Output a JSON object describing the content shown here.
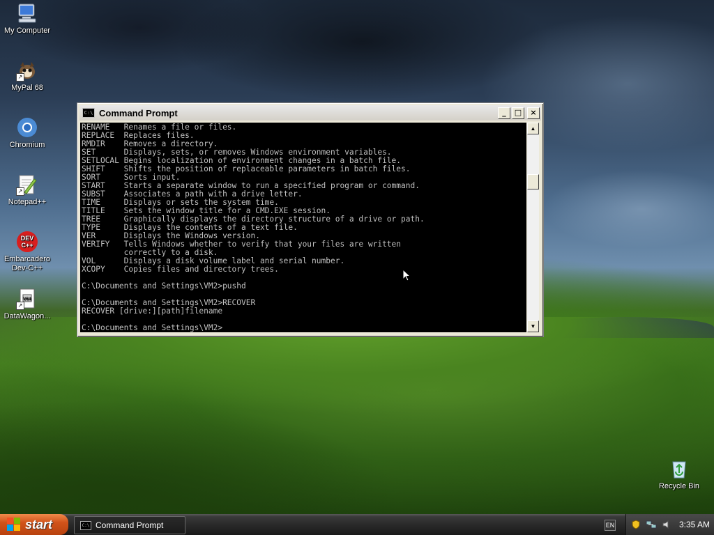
{
  "desktop": {
    "icons": [
      {
        "label": "My Computer",
        "icon": "my-computer-icon"
      },
      {
        "label": "MyPal 68",
        "icon": "mypal-icon"
      },
      {
        "label": "Chromium",
        "icon": "chromium-icon"
      },
      {
        "label": "Notepad++",
        "icon": "notepadpp-icon"
      },
      {
        "label": "Embarcadero Dev-C++",
        "line1": "Embarcadero",
        "line2": "Dev-C++",
        "icon": "devcpp-icon",
        "badge": "DEV\nC++"
      },
      {
        "label": "DataWagon...",
        "icon": "datawagon-icon"
      },
      {
        "label": "Recycle Bin",
        "icon": "recycle-bin-icon"
      }
    ]
  },
  "window": {
    "title": "Command Prompt",
    "icon_text": "C:\\",
    "buttons": {
      "minimize": "_",
      "maximize": "□",
      "close": "×"
    },
    "console_lines": [
      "RENAME   Renames a file or files.",
      "REPLACE  Replaces files.",
      "RMDIR    Removes a directory.",
      "SET      Displays, sets, or removes Windows environment variables.",
      "SETLOCAL Begins localization of environment changes in a batch file.",
      "SHIFT    Shifts the position of replaceable parameters in batch files.",
      "SORT     Sorts input.",
      "START    Starts a separate window to run a specified program or command.",
      "SUBST    Associates a path with a drive letter.",
      "TIME     Displays or sets the system time.",
      "TITLE    Sets the window title for a CMD.EXE session.",
      "TREE     Graphically displays the directory structure of a drive or path.",
      "TYPE     Displays the contents of a text file.",
      "VER      Displays the Windows version.",
      "VERIFY   Tells Windows whether to verify that your files are written",
      "         correctly to a disk.",
      "VOL      Displays a disk volume label and serial number.",
      "XCOPY    Copies files and directory trees.",
      "",
      "C:\\Documents and Settings\\VM2>pushd",
      "",
      "C:\\Documents and Settings\\VM2>RECOVER",
      "RECOVER [drive:][path]filename",
      "",
      "C:\\Documents and Settings\\VM2>"
    ],
    "scrollbar": {
      "up": "▲",
      "down": "▼"
    }
  },
  "taskbar": {
    "start_label": "start",
    "task_label": "Command Prompt",
    "language": "EN",
    "clock": "3:35 AM",
    "tray_icons": [
      "security-shield-icon",
      "network-icon",
      "volume-icon"
    ]
  }
}
